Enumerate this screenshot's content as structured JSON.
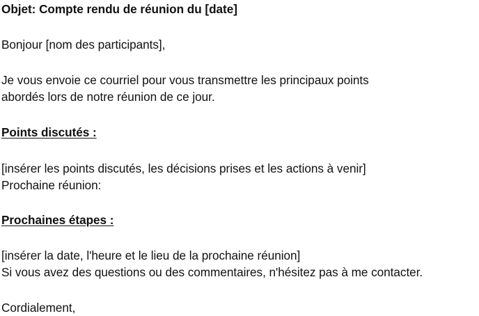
{
  "email": {
    "subject": "Objet: Compte rendu de réunion du [date]",
    "greeting": "Bonjour [nom des participants],",
    "intro_line1": "Je vous envoie ce courriel pour vous transmettre les principaux points",
    "intro_line2": "abordés lors de notre réunion de ce jour.",
    "section1_heading": "Points discutés :",
    "section1_body": "[insérer les points discutés, les décisions prises et les actions à venir]",
    "next_meeting_label": "Prochaine réunion:",
    "section2_heading": "Prochaines étapes :",
    "section2_body": "[insérer la date, l'heure et le lieu de la prochaine réunion]",
    "closing_line": "Si vous avez des questions ou des commentaires, n'hésitez pas à me contacter.",
    "signoff": "Cordialement,"
  }
}
